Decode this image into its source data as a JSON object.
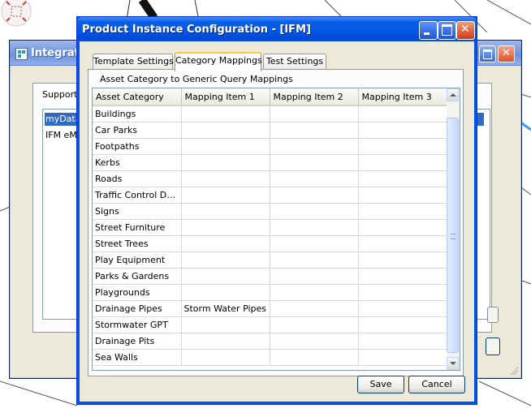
{
  "background_window": {
    "title": "Integratio",
    "tab_label": "Supporte",
    "list_items": [
      "myData",
      "IFM eMa"
    ]
  },
  "dialog": {
    "title": "Product Instance Configuration - [IFM]",
    "tabs": [
      {
        "label": "Template Settings",
        "active": false
      },
      {
        "label": "Category Mappings",
        "active": true
      },
      {
        "label": "Test Settings",
        "active": false
      }
    ],
    "group_label": "Asset Category to Generic Query Mappings",
    "grid": {
      "columns": [
        "Asset Category",
        "Mapping Item 1",
        "Mapping Item 2",
        "Mapping Item 3"
      ],
      "rows": [
        [
          "Buildings",
          "",
          "",
          ""
        ],
        [
          "Car Parks",
          "",
          "",
          ""
        ],
        [
          "Footpaths",
          "",
          "",
          ""
        ],
        [
          "Kerbs",
          "",
          "",
          ""
        ],
        [
          "Roads",
          "",
          "",
          ""
        ],
        [
          "Traffic Control Dev…",
          "",
          "",
          ""
        ],
        [
          "Signs",
          "",
          "",
          ""
        ],
        [
          "Street Furniture",
          "",
          "",
          ""
        ],
        [
          "Street Trees",
          "",
          "",
          ""
        ],
        [
          "Play Equipment",
          "",
          "",
          ""
        ],
        [
          "Parks & Gardens",
          "",
          "",
          ""
        ],
        [
          "Playgrounds",
          "",
          "",
          ""
        ],
        [
          "Drainage Pipes",
          "Storm Water Pipes",
          "",
          ""
        ],
        [
          "Stormwater GPT",
          "",
          "",
          ""
        ],
        [
          "Drainage Pits",
          "",
          "",
          ""
        ],
        [
          "Sea Walls",
          "",
          "",
          ""
        ]
      ]
    },
    "buttons": {
      "save_label": "Save",
      "cancel_label": "Cancel"
    }
  },
  "colors": {
    "titlebar_active": "#0058e6",
    "titlebar_inactive": "#7a9de0",
    "dialog_face": "#ece9d8",
    "tab_highlight": "#ffc83c",
    "selection": "#316ac5"
  }
}
